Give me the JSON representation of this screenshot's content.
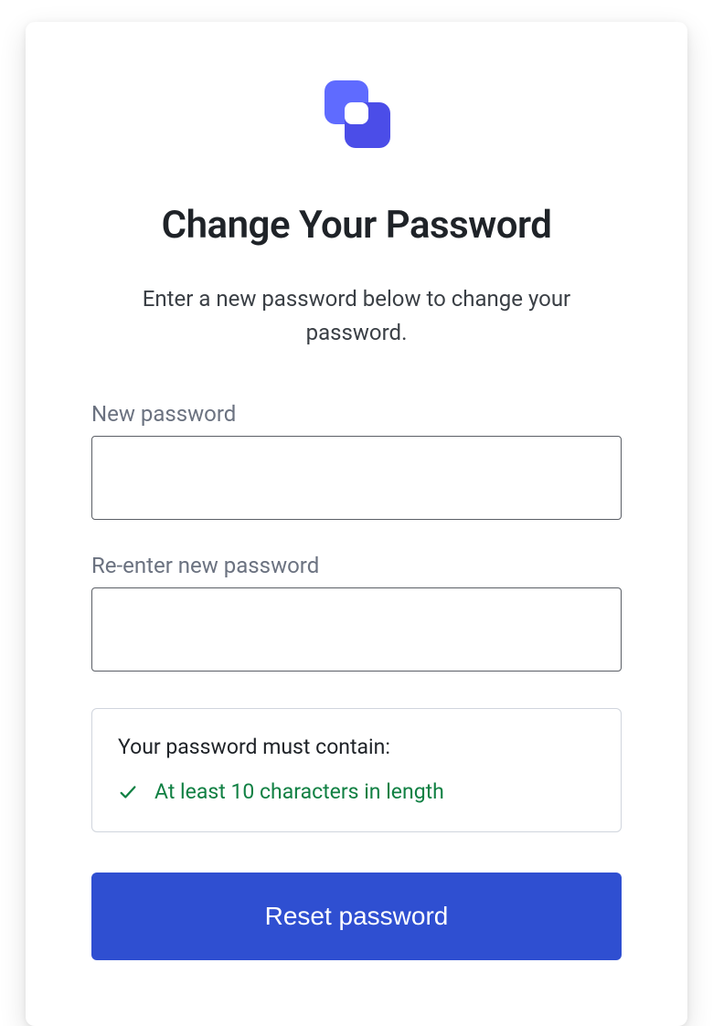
{
  "header": {
    "title": "Change Your Password",
    "subtitle": "Enter a new password below to change your password."
  },
  "form": {
    "new_password": {
      "label": "New password",
      "value": ""
    },
    "confirm_password": {
      "label": "Re-enter new password",
      "value": ""
    },
    "requirements": {
      "title": "Your password must contain:",
      "items": [
        {
          "text": "At least 10 characters in length",
          "met": true
        }
      ]
    },
    "submit_label": "Reset password"
  },
  "colors": {
    "primary": "#2f4fd1",
    "success": "#108043",
    "logo_light": "#6b7aff",
    "logo_dark": "#4b4de8"
  }
}
